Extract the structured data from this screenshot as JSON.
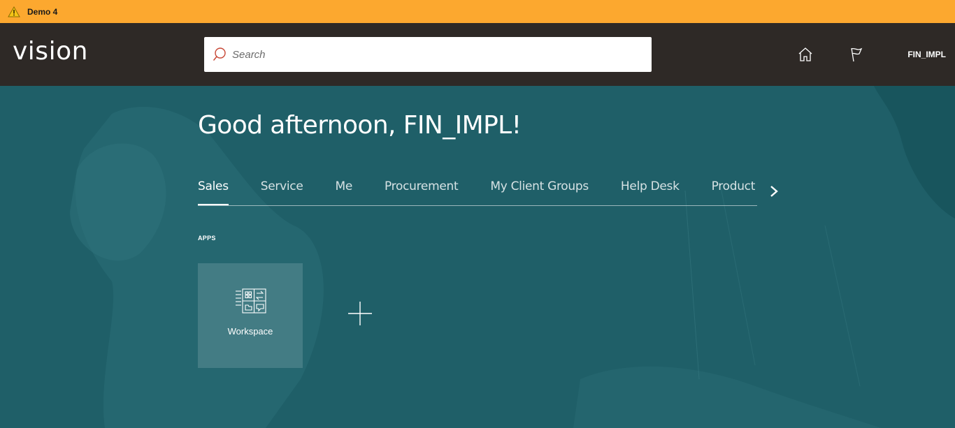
{
  "banner": {
    "env_name": "Demo 4"
  },
  "header": {
    "logo": "vision",
    "search": {
      "placeholder": "Search",
      "value": ""
    },
    "icons": [
      "home-icon",
      "flag-icon"
    ],
    "user": "FIN_IMPL"
  },
  "main": {
    "greeting": "Good afternoon, FIN_IMPL!",
    "tabs": [
      {
        "label": "Sales",
        "active": true
      },
      {
        "label": "Service"
      },
      {
        "label": "Me"
      },
      {
        "label": "Procurement"
      },
      {
        "label": "My Client Groups"
      },
      {
        "label": "Help Desk"
      },
      {
        "label": "Product Ma"
      }
    ],
    "apps_label": "APPS",
    "apps": [
      {
        "label": "Workspace",
        "icon": "workspace-icon"
      }
    ],
    "add_icon": "plus-icon"
  },
  "colors": {
    "banner": "#fca82f",
    "header": "#2e2926",
    "background": "#1f5f68",
    "search_icon": "#c74634"
  }
}
